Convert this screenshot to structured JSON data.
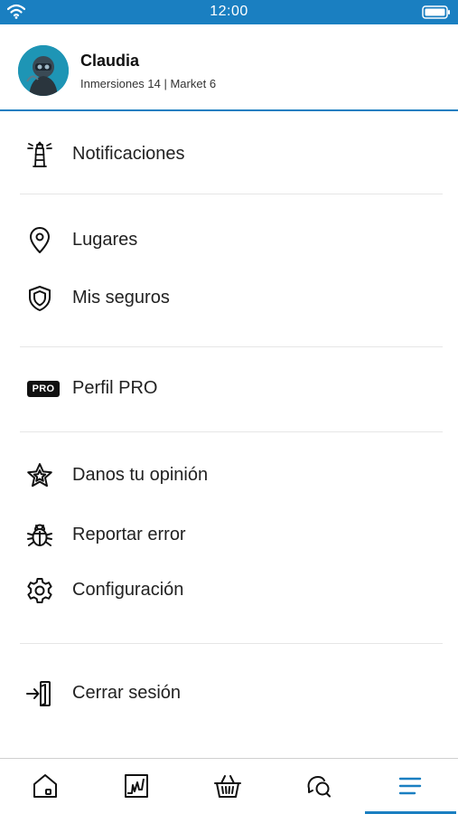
{
  "status_bar": {
    "time": "12:00"
  },
  "profile": {
    "name": "Claudia",
    "stats": "Inmersiones 14 | Market 6"
  },
  "menu": {
    "notifications": "Notificaciones",
    "places": "Lugares",
    "insurance": "Mis seguros",
    "pro_badge": "PRO",
    "pro_profile": "Perfil PRO",
    "feedback": "Danos tu opinión",
    "report_bug": "Reportar error",
    "settings": "Configuración",
    "logout": "Cerrar sesión"
  },
  "bottom_nav": {
    "tabs": [
      "home-icon",
      "logbook-chart-icon",
      "market-basket-icon",
      "chat-icon",
      "menu-icon"
    ],
    "active_tab": "menu-icon"
  },
  "colors": {
    "accent": "#1a7fc1",
    "text": "#222222"
  }
}
